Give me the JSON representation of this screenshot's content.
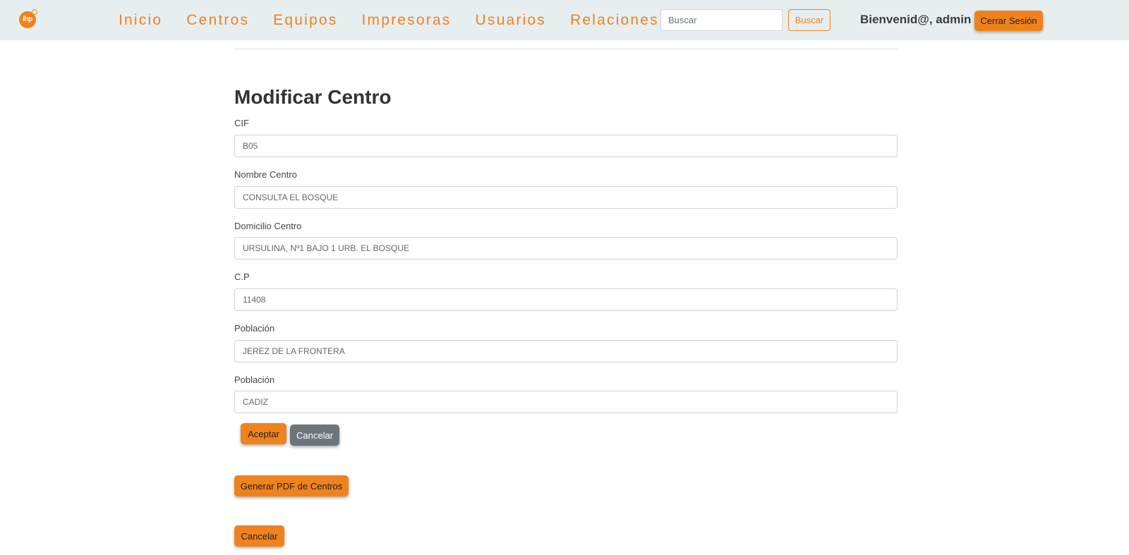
{
  "navbar": {
    "logo_text": "ihp",
    "links": [
      "Inicio",
      "Centros",
      "Equipos",
      "Impresoras",
      "Usuarios",
      "Relaciones"
    ],
    "search_placeholder": "Buscar",
    "search_button": "Buscar",
    "welcome": "Bienvenid@, admin",
    "logout": "Cerrar Sesión"
  },
  "form": {
    "title": "Modificar Centro",
    "fields": [
      {
        "label": "CIF",
        "value": "B05"
      },
      {
        "label": "Nombre Centro",
        "value": "CONSULTA EL BOSQUE"
      },
      {
        "label": "Domicilio Centro",
        "value": "URSULINA, Nº1 BAJO 1 URB. EL BOSQUE"
      },
      {
        "label": "C.P",
        "value": "11408"
      },
      {
        "label": "Población",
        "value": "JEREZ DE LA FRONTERA"
      },
      {
        "label": "Población",
        "value": "CADIZ"
      }
    ],
    "accept": "Aceptar",
    "cancel": "Cancelar"
  },
  "actions": {
    "generate_pdf": "Generar PDF de Centros",
    "cancel": "Cancelar"
  },
  "colors": {
    "accent": "#f0821e",
    "navbar_bg": "#e7eef0",
    "secondary": "#6c757d"
  }
}
